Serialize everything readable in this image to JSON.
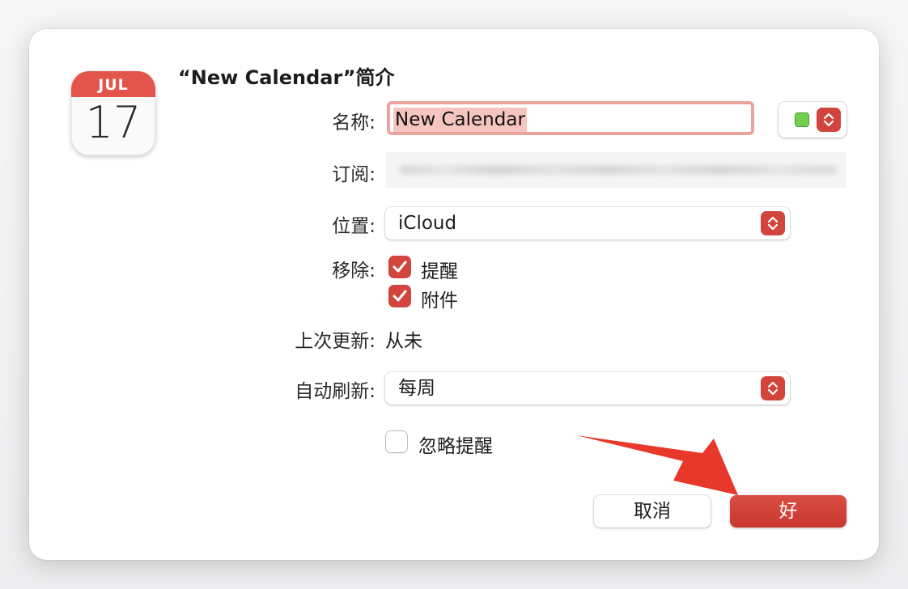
{
  "dialog": {
    "title": "“New Calendar”简介"
  },
  "calendar_icon": {
    "month": "JUL",
    "day": "17"
  },
  "fields": {
    "name_label": "名称:",
    "name_value": "New Calendar",
    "subscription_label": "订阅:",
    "location_label": "位置:",
    "location_value": "iCloud",
    "remove_label": "移除:",
    "remove_reminders_label": "提醒",
    "remove_attachments_label": "附件",
    "last_updated_label": "上次更新:",
    "last_updated_value": "从未",
    "auto_refresh_label": "自动刷新:",
    "auto_refresh_value": "每周",
    "ignore_reminders_label": "忽略提醒"
  },
  "checkboxes": {
    "remove_reminders": true,
    "remove_attachments": true,
    "ignore_reminders": false
  },
  "colors": {
    "calendar_color": "#70d04e",
    "accent": "#d2453c",
    "annotation_arrow": "#e8382a"
  },
  "buttons": {
    "cancel": "取消",
    "ok": "好"
  }
}
